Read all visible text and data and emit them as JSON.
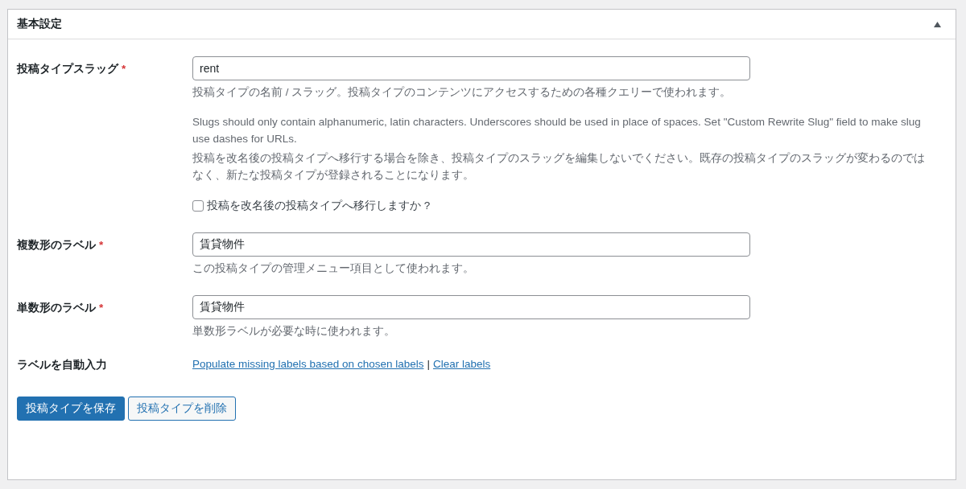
{
  "panel": {
    "title": "基本設定",
    "expanded": true
  },
  "fields": [
    {
      "kind": "text",
      "label": "投稿タイプスラッグ",
      "required_mark": "*",
      "value": "rent",
      "description": "投稿タイプの名前 / スラッグ。投稿タイプのコンテンツにアクセスするための各種クエリーで使われます。",
      "notes": [
        "Slugs should only contain alphanumeric, latin characters. Underscores should be used in place of spaces. Set \"Custom Rewrite Slug\" field to make slug use dashes for URLs.",
        "投稿を改名後の投稿タイプへ移行する場合を除き、投稿タイプのスラッグを編集しないでください。既存の投稿タイプのスラッグが変わるのではなく、新たな投稿タイプが登録されることになります。"
      ],
      "checkbox": {
        "label": "投稿を改名後の投稿タイプへ移行しますか ?",
        "checked": false
      }
    },
    {
      "kind": "text",
      "label": "複数形のラベル",
      "required_mark": "*",
      "value": "賃貸物件",
      "description": "この投稿タイプの管理メニュー項目として使われます。"
    },
    {
      "kind": "text",
      "label": "単数形のラベル",
      "required_mark": "*",
      "value": "賃貸物件",
      "description": "単数形ラベルが必要な時に使われます。"
    },
    {
      "kind": "links",
      "label": "ラベルを自動入力",
      "links": [
        "Populate missing labels based on chosen labels",
        "Clear labels"
      ],
      "separator": "|"
    }
  ],
  "buttons": [
    {
      "label": "投稿タイプを保存",
      "kind": "primary"
    },
    {
      "label": "投稿タイプを削除",
      "kind": "secondary"
    }
  ]
}
